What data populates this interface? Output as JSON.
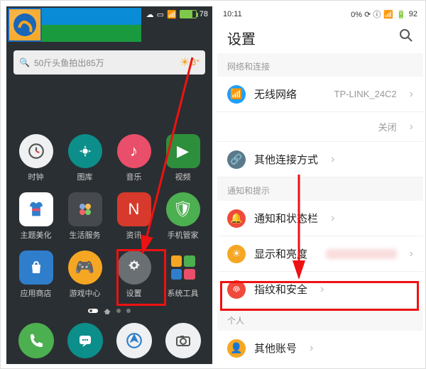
{
  "left": {
    "status": {
      "battery": "78"
    },
    "search": {
      "placeholder": "50斤头鱼拍出85万",
      "weather": "3°"
    },
    "apps": [
      {
        "name": "clock",
        "label": "时钟",
        "icon": "clock",
        "cls": "ic-white"
      },
      {
        "name": "gallery",
        "label": "图库",
        "icon": "gallery",
        "cls": "ic-teal"
      },
      {
        "name": "music",
        "label": "音乐",
        "icon": "music",
        "cls": "ic-pink"
      },
      {
        "name": "video",
        "label": "视频",
        "icon": "play",
        "cls": "ic-green square"
      },
      {
        "name": "theme",
        "label": "主题美化",
        "icon": "shirt",
        "cls": "ic-blue square"
      },
      {
        "name": "life",
        "label": "生活服务",
        "icon": "life",
        "cls": "ic-dgrey square"
      },
      {
        "name": "news",
        "label": "资讯",
        "icon": "news",
        "cls": "ic-red square"
      },
      {
        "name": "security",
        "label": "手机管家",
        "icon": "shield",
        "cls": "ic-lgreen"
      },
      {
        "name": "appstore",
        "label": "应用商店",
        "icon": "bag",
        "cls": "ic-dblue square"
      },
      {
        "name": "gamecenter",
        "label": "游戏中心",
        "icon": "game",
        "cls": "ic-orange"
      },
      {
        "name": "settings",
        "label": "设置",
        "icon": "gear",
        "cls": "ic-gear"
      },
      {
        "name": "tools",
        "label": "系统工具",
        "icon": "tiles",
        "cls": "ic-tiles square"
      }
    ],
    "dock": [
      {
        "name": "phone",
        "cls": "ic-lgreen",
        "icon": "phone"
      },
      {
        "name": "sms",
        "cls": "ic-teal",
        "icon": "chat"
      },
      {
        "name": "browser",
        "cls": "ic-white",
        "icon": "web"
      },
      {
        "name": "camera",
        "cls": "ic-white",
        "icon": "cam"
      }
    ]
  },
  "right": {
    "status": {
      "time": "10:11",
      "battery": "92",
      "extras": "0% ⟳ ⓘ"
    },
    "title": "设置",
    "sections": [
      {
        "header": "网络和连接",
        "rows": [
          {
            "name": "wifi",
            "icon": "wifi",
            "cls": "ric-wifi",
            "label": "无线网络",
            "value": "TP-LINK_24C2"
          },
          {
            "name": "hotspot",
            "sub": true,
            "label": "",
            "value": "关闭"
          },
          {
            "name": "other-conn",
            "icon": "link",
            "cls": "ric-link",
            "label": "其他连接方式",
            "value": ""
          }
        ]
      },
      {
        "header": "通知和提示",
        "rows": [
          {
            "name": "notif",
            "icon": "bell",
            "cls": "ric-bell",
            "label": "通知和状态栏",
            "value": ""
          },
          {
            "name": "display",
            "icon": "sun",
            "cls": "ric-sun",
            "label": "显示和亮度",
            "value": "",
            "blur": true
          },
          {
            "name": "finger",
            "icon": "finger",
            "cls": "ric-finger",
            "label": "指纹和安全",
            "value": ""
          }
        ]
      },
      {
        "header": "个人",
        "rows": [
          {
            "name": "account",
            "icon": "acct",
            "cls": "ric-acct",
            "label": "其他账号",
            "value": ""
          }
        ]
      }
    ]
  }
}
